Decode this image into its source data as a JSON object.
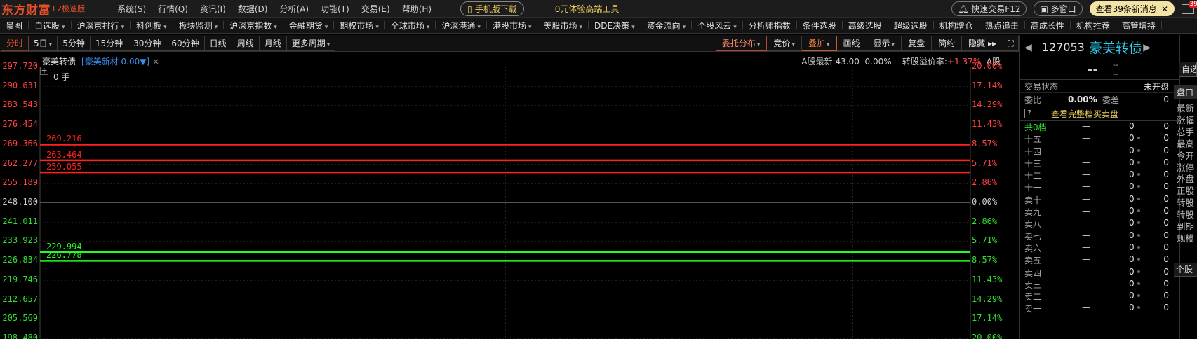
{
  "app": {
    "logo": "东方财富",
    "edition": "L2极速版"
  },
  "sys_menu": [
    "系统(S)",
    "行情(Q)",
    "资讯(I)",
    "数据(D)",
    "分析(A)",
    "功能(T)",
    "交易(E)",
    "帮助(H)"
  ],
  "mobile_download": "手机版下载",
  "experience_link": "0元体验高端工具",
  "right_tools": {
    "quick_trade": "快速交易F12",
    "multi_window": "多窗口",
    "news": "查看39条新消息",
    "mail_badge": "39"
  },
  "main_nav": [
    {
      "label": "景图",
      "dd": false
    },
    {
      "label": "自选股",
      "dd": true
    },
    {
      "label": "沪深京排行",
      "dd": true
    },
    {
      "label": "科创板",
      "dd": true
    },
    {
      "label": "板块监测",
      "dd": true
    },
    {
      "label": "沪深京指数",
      "dd": true
    },
    {
      "label": "金融期货",
      "dd": true
    },
    {
      "label": "期权市场",
      "dd": true
    },
    {
      "label": "全球市场",
      "dd": true
    },
    {
      "label": "沪深港通",
      "dd": true
    },
    {
      "label": "港股市场",
      "dd": true
    },
    {
      "label": "美股市场",
      "dd": true
    },
    {
      "label": "DDE决策",
      "dd": true
    },
    {
      "label": "资金流向",
      "dd": true
    },
    {
      "label": "个股风云",
      "dd": true
    },
    {
      "label": "分析师指数",
      "dd": false
    },
    {
      "label": "条件选股",
      "dd": false
    },
    {
      "label": "高级选股",
      "dd": false
    },
    {
      "label": "超级选股",
      "dd": false
    },
    {
      "label": "机构增仓",
      "dd": false
    },
    {
      "label": "热点追击",
      "dd": false
    },
    {
      "label": "高成长性",
      "dd": false
    },
    {
      "label": "机构推荐",
      "dd": false
    },
    {
      "label": "高管增持",
      "dd": false
    }
  ],
  "periods": [
    {
      "label": "分时",
      "dd": false,
      "active": true
    },
    {
      "label": "5日",
      "dd": true,
      "active": false
    },
    {
      "label": "5分钟",
      "dd": false,
      "active": false
    },
    {
      "label": "15分钟",
      "dd": false,
      "active": false
    },
    {
      "label": "30分钟",
      "dd": false,
      "active": false
    },
    {
      "label": "60分钟",
      "dd": false,
      "active": false
    },
    {
      "label": "日线",
      "dd": false,
      "active": false
    },
    {
      "label": "周线",
      "dd": false,
      "active": false
    },
    {
      "label": "月线",
      "dd": false,
      "active": false
    },
    {
      "label": "更多周期",
      "dd": true,
      "active": false
    }
  ],
  "chart_tools": {
    "order_dist": "委托分布",
    "bidding": "竞价",
    "overlay": "叠加",
    "draw_line": "画线",
    "display": "显示",
    "replay": "复盘",
    "compact": "简约",
    "hide": "隐藏"
  },
  "chart": {
    "title": "豪美转债",
    "overlay_tag": "[豪美新材 0.00▼]",
    "overlay_close": "×",
    "a_share_label": "A股最新:",
    "a_share_price": "43.00",
    "a_share_pct": "0.00%",
    "premium_label": "转股溢价率:",
    "premium_value": "+1.37%",
    "tail": "A股",
    "volume_label": "0 手",
    "plus": "+"
  },
  "chart_data": {
    "type": "line",
    "prev_close": 248.1,
    "y_price_ticks": [
      "297.720",
      "290.631",
      "283.543",
      "276.454",
      "269.366",
      "262.277",
      "255.189",
      "248.100",
      "241.011",
      "233.923",
      "226.834",
      "219.746",
      "212.657",
      "205.569",
      "198.480"
    ],
    "y_pct_ticks": [
      "20.00%",
      "17.14%",
      "14.29%",
      "11.43%",
      "8.57%",
      "5.71%",
      "2.86%",
      "0.00%",
      "2.86%",
      "5.71%",
      "8.57%",
      "11.43%",
      "14.29%",
      "17.14%",
      "20.00%"
    ],
    "ylim": [
      198.48,
      297.72
    ],
    "levels": [
      {
        "value": 269.216,
        "label": "269.216",
        "color": "#ff2020"
      },
      {
        "value": 263.464,
        "label": "263.464",
        "color": "#ff2020"
      },
      {
        "value": 259.055,
        "label": "259.055",
        "color": "#ff2020"
      },
      {
        "value": 229.994,
        "label": "229.994",
        "color": "#20ff20"
      },
      {
        "value": 226.778,
        "label": "226.778",
        "color": "#20ff20"
      }
    ]
  },
  "panel": {
    "code": "127053",
    "name": "豪美转债",
    "price": "--",
    "chg1": "--",
    "chg2": "--",
    "status_label": "交易状态",
    "status_value": "未开盘",
    "wb_label": "委比",
    "wb_value": "0.00%",
    "wc_label": "委差",
    "wc_value": "0",
    "full_book": "查看完整档买卖盘",
    "q_icon": "?",
    "total_label": "共0档",
    "total_price": "—",
    "total_qty": "0",
    "total_cnt": "0",
    "levels": [
      "十五",
      "十四",
      "十三",
      "十二",
      "十一",
      "卖十",
      "卖九",
      "卖八",
      "卖七",
      "卖六",
      "卖五",
      "卖四",
      "卖三",
      "卖二",
      "卖一"
    ],
    "dash": "—",
    "zero": "0"
  },
  "strip": {
    "self": "自选",
    "tab": "盘口",
    "items": [
      "最新",
      "涨幅",
      "总手",
      "最高",
      "今开",
      "涨停",
      "外盘",
      "正股",
      "转股",
      "转股",
      "到期",
      "规模"
    ],
    "bottom": "个股"
  },
  "colors": {
    "up": "#ff2020",
    "down": "#20ff20",
    "accent": "#e8502a",
    "name": "#30d0f0"
  }
}
